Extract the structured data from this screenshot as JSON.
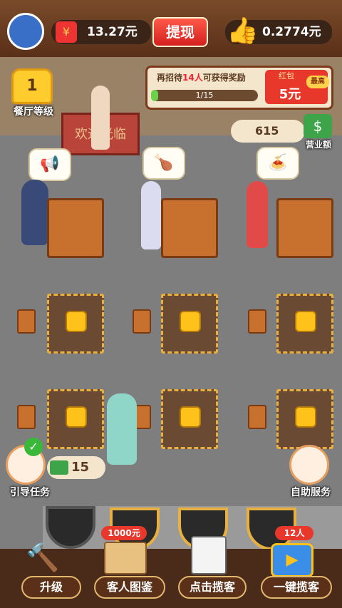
{
  "topbar": {
    "balance_icon": "red-packet-icon",
    "balance": "13.27元",
    "withdraw_label": "提现",
    "like_icon": "thumbs-up-icon",
    "like_value": "0.2774元"
  },
  "restaurant": {
    "level_value": "1",
    "level_label": "餐厅等级",
    "door_sign": "欢迎光临"
  },
  "task": {
    "text_prefix": "再招待",
    "text_count": "14人",
    "text_suffix": "可获得奖励",
    "progress": "1/15",
    "progress_fraction": 0.0667,
    "reward_title": "红包",
    "reward_value": "5元",
    "reward_badge": "最高"
  },
  "revenue": {
    "value": "615",
    "label": "营业额"
  },
  "guide": {
    "label": "引导任务",
    "cash": "15"
  },
  "self_service": {
    "label": "自助服务"
  },
  "bottom": {
    "upgrade": "升级",
    "catalog": "客人图鉴",
    "catalog_badge": "1000元",
    "click_attract": "点击揽客",
    "one_key": "一键揽客",
    "one_key_badge": "12人"
  },
  "colors": {
    "accent_red": "#e8382c",
    "gold": "#ffc21a",
    "wood": "#c8702e"
  }
}
